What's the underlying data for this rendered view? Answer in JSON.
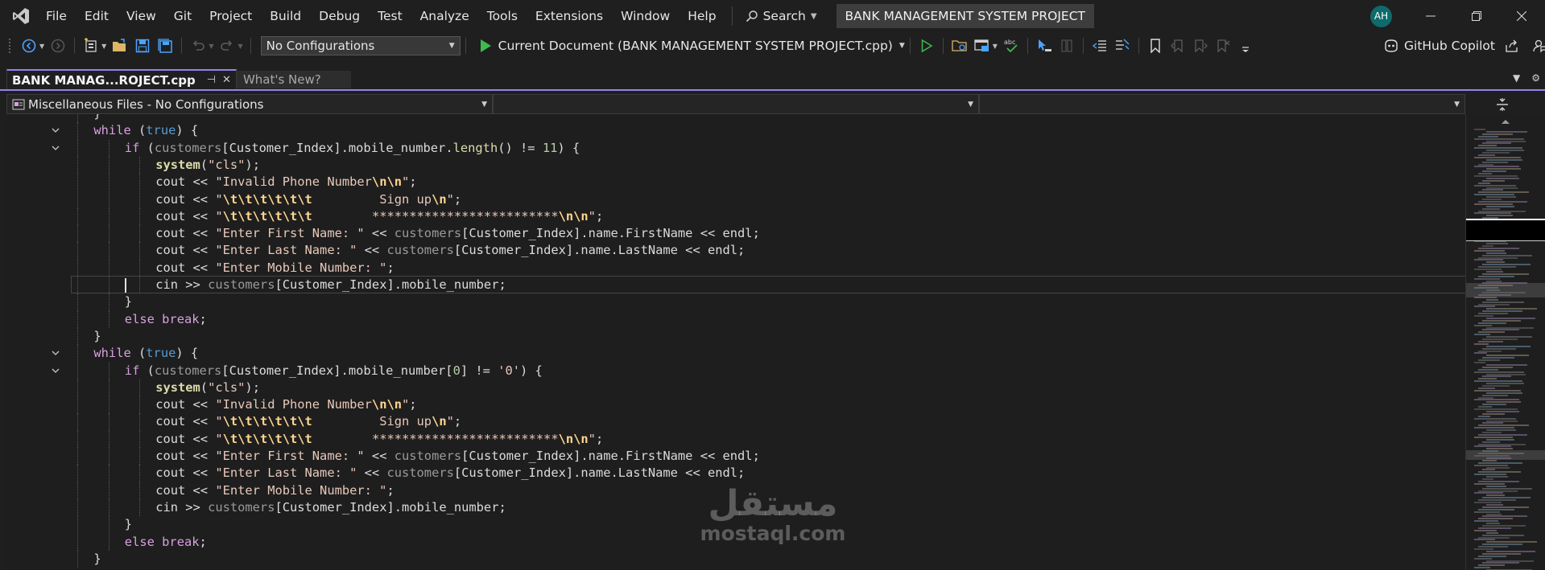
{
  "menu": {
    "items": [
      "File",
      "Edit",
      "View",
      "Git",
      "Project",
      "Build",
      "Debug",
      "Test",
      "Analyze",
      "Tools",
      "Extensions",
      "Window",
      "Help"
    ],
    "search_label": "Search",
    "solution_title": "BANK MANAGEMENT SYSTEM PROJECT",
    "user_initials": "AH"
  },
  "toolbar": {
    "configuration": "No Configurations",
    "run_target": "Current Document (BANK MANAGEMENT SYSTEM PROJECT.cpp)",
    "copilot_label": "GitHub Copilot"
  },
  "tabs": {
    "active_label": "BANK MANAG...ROJECT.cpp",
    "inactive_label": "What's New?"
  },
  "navbar": {
    "scope": "Miscellaneous Files - No Configurations",
    "member": "",
    "function": ""
  },
  "editor": {
    "lines": [
      [
        [
          "p",
          "}"
        ]
      ],
      [
        [
          "k",
          "while"
        ],
        [
          "p",
          " ("
        ],
        [
          "b",
          "true"
        ],
        [
          "p",
          ") {"
        ]
      ],
      [
        [
          "k",
          "if"
        ],
        [
          "p",
          " ("
        ],
        [
          "v",
          "customers"
        ],
        [
          "p",
          "["
        ],
        [
          "p",
          "Customer_Index"
        ],
        [
          "p",
          "]."
        ],
        [
          "f",
          "mobile_number"
        ],
        [
          "p",
          "."
        ],
        [
          "y",
          "length"
        ],
        [
          "p",
          "() != "
        ],
        [
          "n",
          "11"
        ],
        [
          "p",
          ") {"
        ]
      ],
      [
        [
          "y",
          "system"
        ],
        [
          "p",
          "("
        ],
        [
          "s",
          "\"cls\""
        ],
        [
          "p",
          ");"
        ]
      ],
      [
        [
          "p",
          "cout << "
        ],
        [
          "s",
          "\"Invalid Phone Number"
        ],
        [
          "e",
          "\\n\\n"
        ],
        [
          "s",
          "\""
        ],
        [
          "p",
          ";"
        ]
      ],
      [
        [
          "p",
          "cout << "
        ],
        [
          "s",
          "\""
        ],
        [
          "e",
          "\\t\\t\\t\\t\\t\\t"
        ],
        [
          "s",
          "         Sign up"
        ],
        [
          "e",
          "\\n"
        ],
        [
          "s",
          "\""
        ],
        [
          "p",
          ";"
        ]
      ],
      [
        [
          "p",
          "cout << "
        ],
        [
          "s",
          "\""
        ],
        [
          "e",
          "\\t\\t\\t\\t\\t\\t"
        ],
        [
          "s",
          "        *************************"
        ],
        [
          "e",
          "\\n\\n"
        ],
        [
          "s",
          "\""
        ],
        [
          "p",
          ";"
        ]
      ],
      [
        [
          "p",
          "cout << "
        ],
        [
          "s",
          "\"Enter First Name: \""
        ],
        [
          "p",
          " << "
        ],
        [
          "v",
          "customers"
        ],
        [
          "p",
          "[Customer_Index]."
        ],
        [
          "f",
          "name"
        ],
        [
          "p",
          "."
        ],
        [
          "f",
          "FirstName"
        ],
        [
          "p",
          " << endl;"
        ]
      ],
      [
        [
          "p",
          "cout << "
        ],
        [
          "s",
          "\"Enter Last Name: \""
        ],
        [
          "p",
          " << "
        ],
        [
          "v",
          "customers"
        ],
        [
          "p",
          "[Customer_Index]."
        ],
        [
          "f",
          "name"
        ],
        [
          "p",
          "."
        ],
        [
          "f",
          "LastName"
        ],
        [
          "p",
          " << endl;"
        ]
      ],
      [
        [
          "p",
          "cout << "
        ],
        [
          "s",
          "\"Enter Mobile Number: \""
        ],
        [
          "p",
          ";"
        ]
      ],
      [
        [
          "p",
          "cin >> "
        ],
        [
          "v",
          "customers"
        ],
        [
          "p",
          "[Customer_Index]."
        ],
        [
          "f",
          "mobile_number"
        ],
        [
          "p",
          ";"
        ]
      ],
      [
        [
          "p",
          "}"
        ]
      ],
      [
        [
          "k",
          "else"
        ],
        [
          "p",
          " "
        ],
        [
          "k",
          "break"
        ],
        [
          "p",
          ";"
        ]
      ],
      [
        [
          "p",
          "}"
        ]
      ],
      [
        [
          "k",
          "while"
        ],
        [
          "p",
          " ("
        ],
        [
          "b",
          "true"
        ],
        [
          "p",
          ") {"
        ]
      ],
      [
        [
          "k",
          "if"
        ],
        [
          "p",
          " ("
        ],
        [
          "v",
          "customers"
        ],
        [
          "p",
          "[Customer_Index]."
        ],
        [
          "f",
          "mobile_number"
        ],
        [
          "p",
          "["
        ],
        [
          "n",
          "0"
        ],
        [
          "p",
          "] != "
        ],
        [
          "s",
          "'0'"
        ],
        [
          "p",
          ") {"
        ]
      ],
      [
        [
          "y",
          "system"
        ],
        [
          "p",
          "("
        ],
        [
          "s",
          "\"cls\""
        ],
        [
          "p",
          ");"
        ]
      ],
      [
        [
          "p",
          "cout << "
        ],
        [
          "s",
          "\"Invalid Phone Number"
        ],
        [
          "e",
          "\\n\\n"
        ],
        [
          "s",
          "\""
        ],
        [
          "p",
          ";"
        ]
      ],
      [
        [
          "p",
          "cout << "
        ],
        [
          "s",
          "\""
        ],
        [
          "e",
          "\\t\\t\\t\\t\\t\\t"
        ],
        [
          "s",
          "         Sign up"
        ],
        [
          "e",
          "\\n"
        ],
        [
          "s",
          "\""
        ],
        [
          "p",
          ";"
        ]
      ],
      [
        [
          "p",
          "cout << "
        ],
        [
          "s",
          "\""
        ],
        [
          "e",
          "\\t\\t\\t\\t\\t\\t"
        ],
        [
          "s",
          "        *************************"
        ],
        [
          "e",
          "\\n\\n"
        ],
        [
          "s",
          "\""
        ],
        [
          "p",
          ";"
        ]
      ],
      [
        [
          "p",
          "cout << "
        ],
        [
          "s",
          "\"Enter First Name: \""
        ],
        [
          "p",
          " << "
        ],
        [
          "v",
          "customers"
        ],
        [
          "p",
          "[Customer_Index]."
        ],
        [
          "f",
          "name"
        ],
        [
          "p",
          "."
        ],
        [
          "f",
          "FirstName"
        ],
        [
          "p",
          " << endl;"
        ]
      ],
      [
        [
          "p",
          "cout << "
        ],
        [
          "s",
          "\"Enter Last Name: \""
        ],
        [
          "p",
          " << "
        ],
        [
          "v",
          "customers"
        ],
        [
          "p",
          "[Customer_Index]."
        ],
        [
          "f",
          "name"
        ],
        [
          "p",
          "."
        ],
        [
          "f",
          "LastName"
        ],
        [
          "p",
          " << endl;"
        ]
      ],
      [
        [
          "p",
          "cout << "
        ],
        [
          "s",
          "\"Enter Mobile Number: \""
        ],
        [
          "p",
          ";"
        ]
      ],
      [
        [
          "p",
          "cin >> "
        ],
        [
          "v",
          "customers"
        ],
        [
          "p",
          "[Customer_Index]."
        ],
        [
          "f",
          "mobile_number"
        ],
        [
          "p",
          ";"
        ]
      ],
      [
        [
          "p",
          "}"
        ]
      ],
      [
        [
          "k",
          "else"
        ],
        [
          "p",
          " "
        ],
        [
          "k",
          "break"
        ],
        [
          "p",
          ";"
        ]
      ],
      [
        [
          "p",
          "}"
        ]
      ]
    ],
    "indent_levels": [
      2,
      2,
      3,
      4,
      4,
      4,
      4,
      4,
      4,
      4,
      4,
      3,
      3,
      2,
      2,
      3,
      4,
      4,
      4,
      4,
      4,
      4,
      4,
      4,
      3,
      3,
      2
    ],
    "fold_lines": [
      1,
      2,
      14,
      15
    ],
    "current_line": 10,
    "token_colors": {
      "k": "#d8a0df",
      "b": "#569cd6",
      "v": "#9a9a9a",
      "f": "#dadada",
      "y": "#dcdcaa",
      "s": "#e8c9bb",
      "e": "#ffd68f",
      "n": "#b5cea8",
      "p": "#dcdcdc"
    }
  },
  "watermark": {
    "arabic": "مستقل",
    "latin": "mostaql.com"
  },
  "colors": {
    "accent": "#9184ee",
    "background": "#1f1f1f",
    "editor_background": "#1e1e1e",
    "run_green": "#3fb950"
  },
  "icons": [
    "vs-logo-icon",
    "search-icon",
    "back-icon",
    "forward-icon",
    "new-project-icon",
    "open-folder-icon",
    "save-icon",
    "save-all-icon",
    "undo-icon",
    "redo-icon",
    "run-icon",
    "start-without-debug-icon",
    "copilot-icon",
    "pin-icon",
    "close-icon",
    "split-icon"
  ]
}
